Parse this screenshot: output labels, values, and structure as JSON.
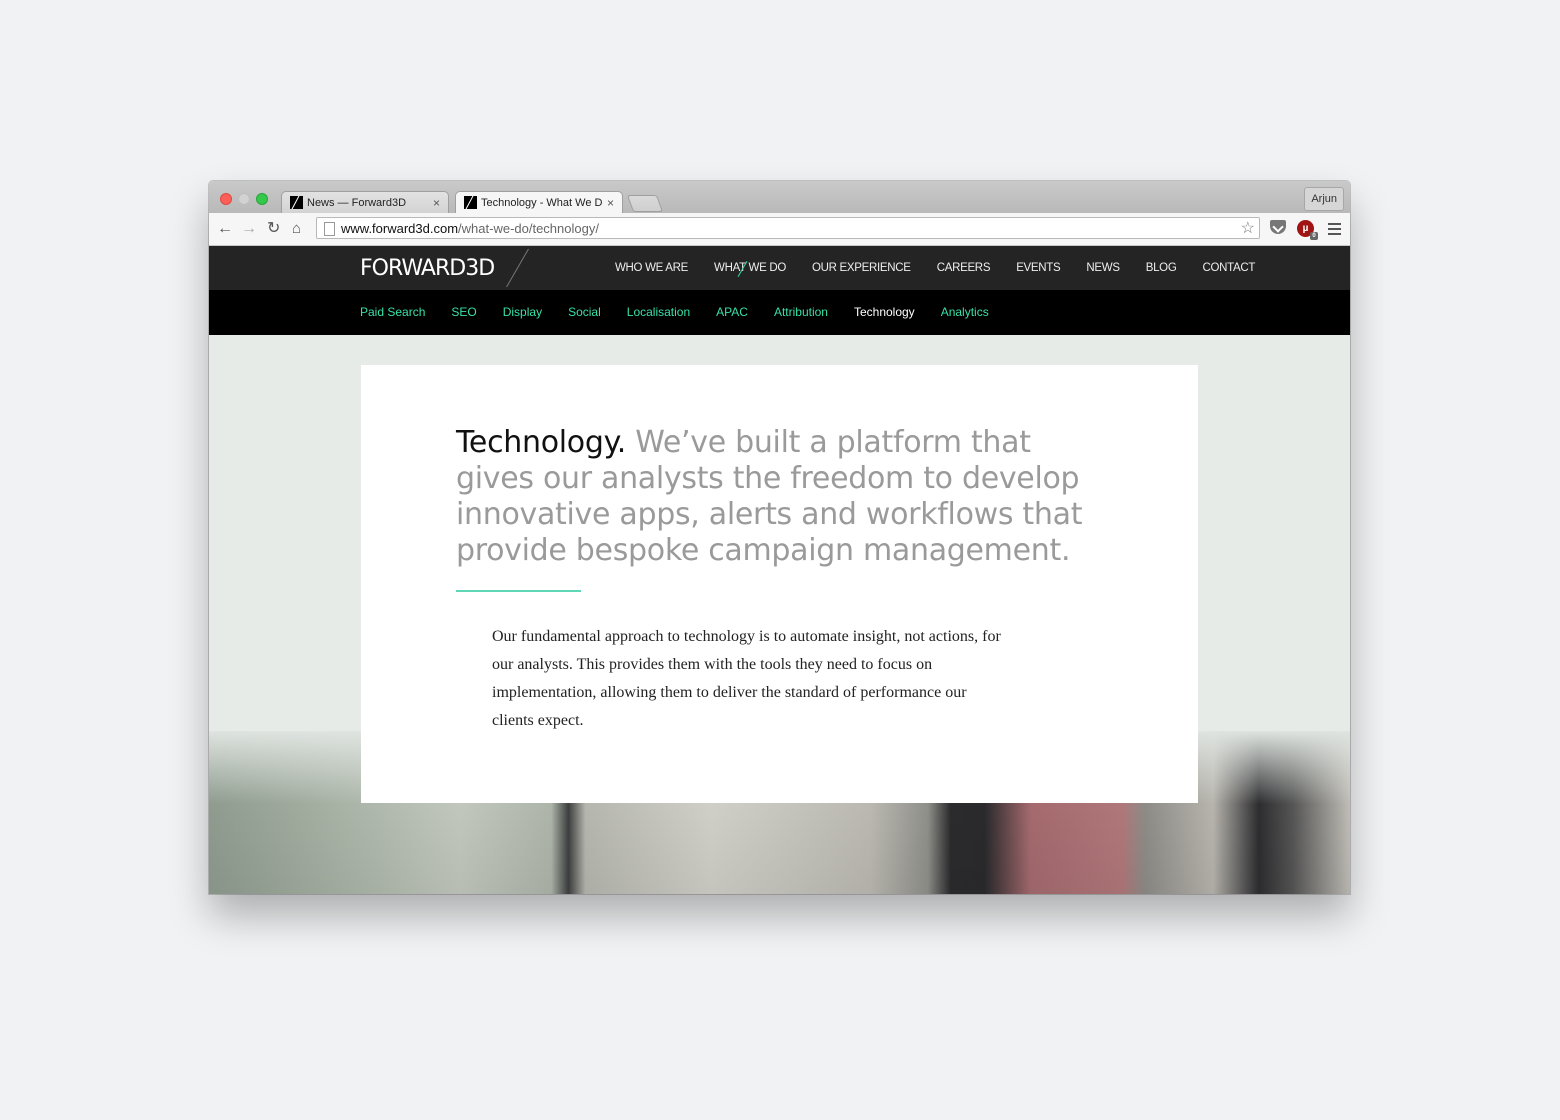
{
  "browser": {
    "tabs": [
      {
        "title": "News — Forward3D",
        "active": false
      },
      {
        "title": "Technology - What We Do",
        "active": true
      }
    ],
    "close_glyph": "×",
    "profile_name": "Arjun",
    "url_host": "www.forward3d.com",
    "url_path": "/what-we-do/technology/",
    "icons": [
      "back-arrow-icon",
      "forward-arrow-icon",
      "reload-icon",
      "home-icon",
      "page-icon",
      "star-icon",
      "pocket-icon",
      "ublock-icon",
      "menu-icon"
    ],
    "ublock_letter": "µ",
    "ublock_badge": "0"
  },
  "site": {
    "logo": "FORWARD3D",
    "main_nav": [
      {
        "label": "WHO WE ARE",
        "current": false
      },
      {
        "label": "WHAT WE DO",
        "current": true
      },
      {
        "label": "OUR EXPERIENCE",
        "current": false
      },
      {
        "label": "CAREERS",
        "current": false
      },
      {
        "label": "EVENTS",
        "current": false
      },
      {
        "label": "NEWS",
        "current": false
      },
      {
        "label": "BLOG",
        "current": false
      },
      {
        "label": "CONTACT",
        "current": false
      }
    ],
    "sub_nav": [
      {
        "label": "Paid Search",
        "active": false
      },
      {
        "label": "SEO",
        "active": false
      },
      {
        "label": "Display",
        "active": false
      },
      {
        "label": "Social",
        "active": false
      },
      {
        "label": "Localisation",
        "active": false
      },
      {
        "label": "APAC",
        "active": false
      },
      {
        "label": "Attribution",
        "active": false
      },
      {
        "label": "Technology",
        "active": true
      },
      {
        "label": "Analytics",
        "active": false
      }
    ],
    "accent_color": "#38e0a8",
    "headline_lead": "Technology.",
    "headline_rest": " We’ve built a platform that gives our analysts the freedom to develop innovative apps, alerts and workflows that provide bespoke campaign management.",
    "body": "Our fundamental approach to technology is to automate insight, not actions, for our analysts. This provides them with the tools they need to focus on implementation, allowing them to deliver the standard of performance our clients expect."
  }
}
